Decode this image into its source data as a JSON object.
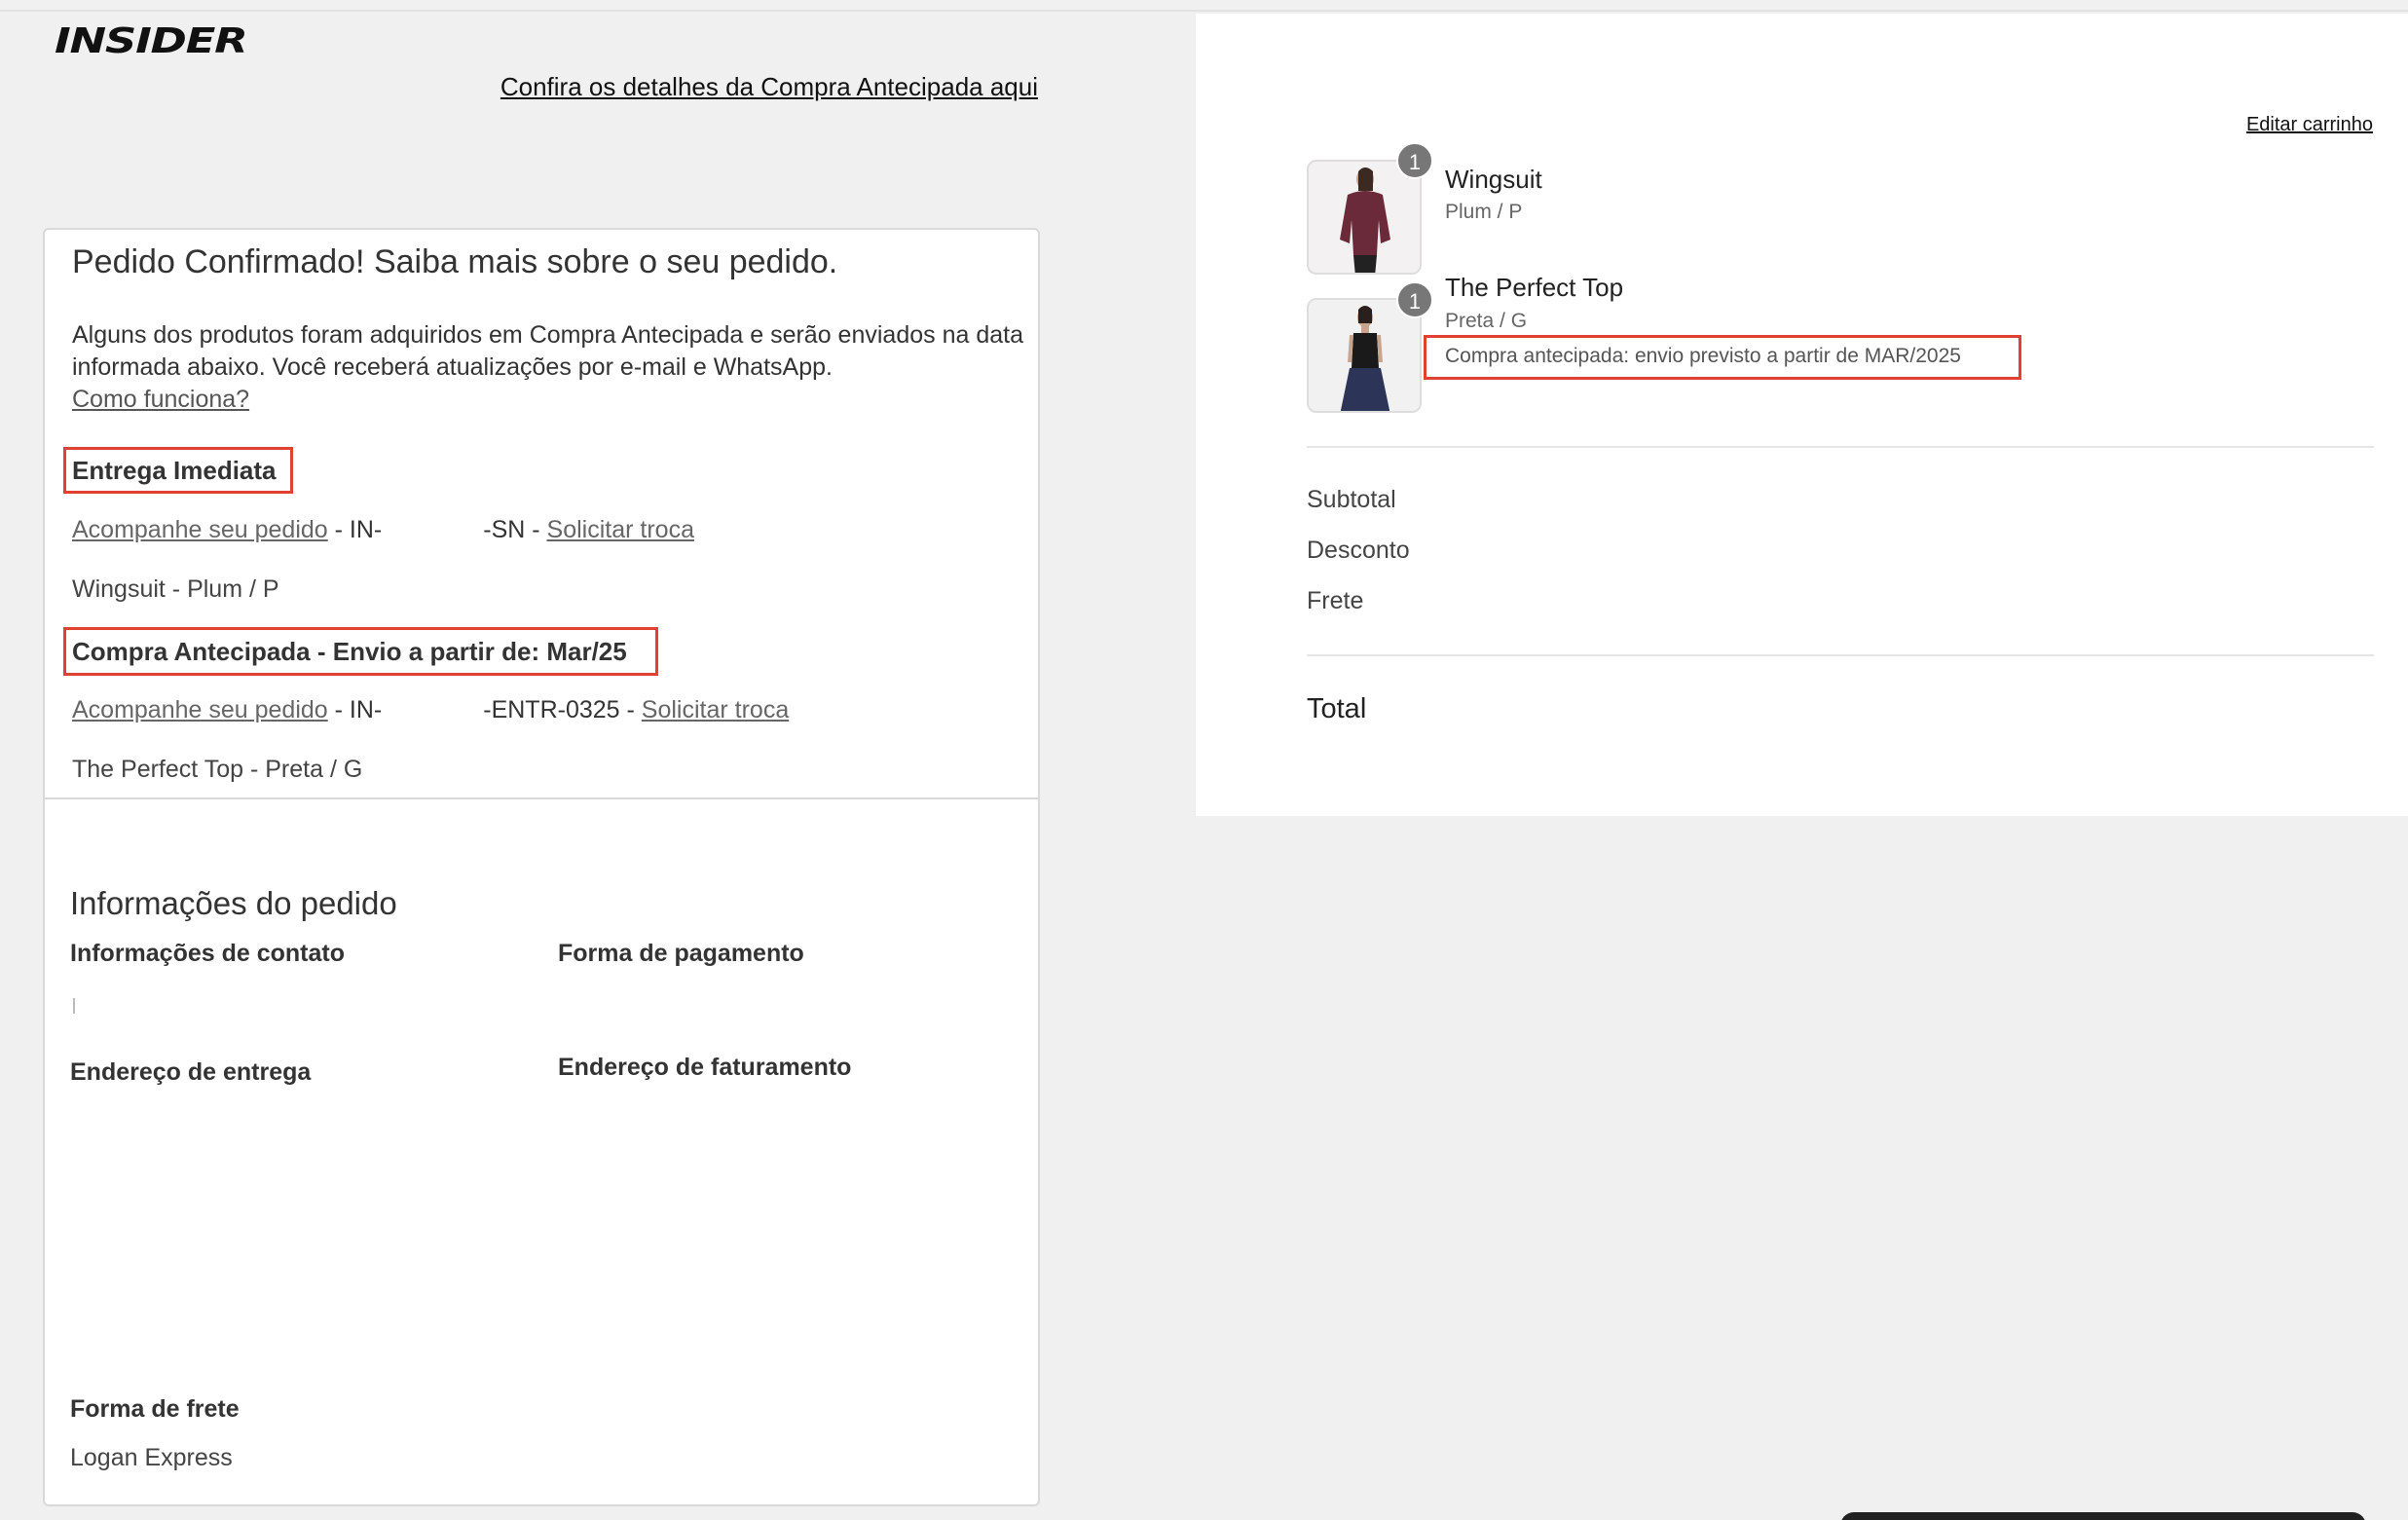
{
  "brand": {
    "logo_text": "INSIDER"
  },
  "header": {
    "details_link": "Confira os detalhes da Compra Antecipada aqui"
  },
  "order": {
    "title": "Pedido Confirmado! Saiba mais sobre o seu pedido.",
    "intro": "Alguns dos produtos foram adquiridos em Compra Antecipada e serão enviados na data informada abaixo. Você receberá atualizações por e-mail e WhatsApp.",
    "how_link": "Como funciona?",
    "immediate": {
      "heading": "Entrega Imediata",
      "track_link": "Acompanhe seu pedido",
      "order_prefix": " - IN-",
      "order_suffix": "-SN - ",
      "exchange_link": "Solicitar troca",
      "item": "Wingsuit - Plum / P"
    },
    "preorder": {
      "heading": "Compra Antecipada - Envio a partir de: Mar/25",
      "track_link": "Acompanhe seu pedido",
      "order_prefix": " - IN-",
      "order_suffix": "-ENTR-0325 - ",
      "exchange_link": "Solicitar troca",
      "item": "The Perfect Top - Preta / G"
    }
  },
  "info": {
    "title": "Informações do pedido",
    "contact_label": "Informações de contato",
    "payment_label": "Forma de pagamento",
    "shipping_address_label": "Endereço de entrega",
    "billing_address_label": "Endereço de faturamento",
    "shipping_method_label": "Forma de frete",
    "shipping_method_value": "Logan Express"
  },
  "cart": {
    "edit_link": "Editar carrinho",
    "items": [
      {
        "name": "Wingsuit",
        "variant": "Plum / P",
        "qty": "1",
        "note": ""
      },
      {
        "name": "The Perfect Top",
        "variant": "Preta / G",
        "qty": "1",
        "note": "Compra antecipada: envio previsto a partir de MAR/2025"
      }
    ],
    "subtotal_label": "Subtotal",
    "discount_label": "Desconto",
    "shipping_label": "Frete",
    "total_label": "Total"
  },
  "colors": {
    "highlight": "#e04132",
    "badge": "#777777",
    "wingsuit": "#6b2a3a",
    "top": "#1a1a1a",
    "skirt": "#2c3558"
  }
}
